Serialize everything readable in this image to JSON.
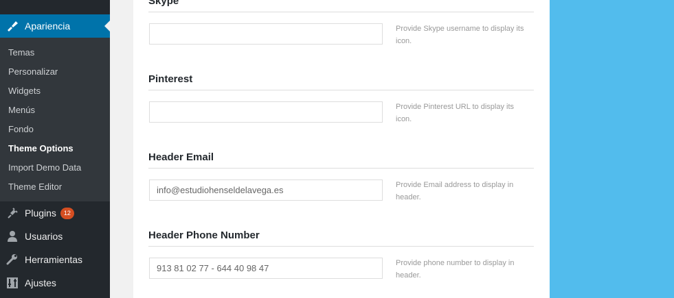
{
  "sidebar": {
    "appearance_label": "Apariencia",
    "submenu": [
      {
        "label": "Temas"
      },
      {
        "label": "Personalizar"
      },
      {
        "label": "Widgets"
      },
      {
        "label": "Menús"
      },
      {
        "label": "Fondo"
      },
      {
        "label": "Theme Options",
        "current": true
      },
      {
        "label": "Import Demo Data"
      },
      {
        "label": "Theme Editor"
      }
    ],
    "plugins_label": "Plugins",
    "plugins_badge": "12",
    "users_label": "Usuarios",
    "tools_label": "Herramientas",
    "settings_label": "Ajustes"
  },
  "fields": {
    "skype": {
      "title": "Skype",
      "value": "",
      "desc": "Provide Skype username to display its icon."
    },
    "pinterest": {
      "title": "Pinterest",
      "value": "",
      "desc": "Provide Pinterest URL to display its icon."
    },
    "email": {
      "title": "Header Email",
      "value": "info@estudiohenseldelavega.es",
      "desc": "Provide Email address to display in header."
    },
    "phone": {
      "title": "Header Phone Number",
      "value": "913 81 02 77 - 644 40 98 47",
      "desc": "Provide phone number to display in header."
    }
  },
  "colors": {
    "sidebar_bg": "#23282d",
    "submenu_bg": "#32373c",
    "active_menu": "#0073aa",
    "badge": "#d54e21",
    "right_area": "#52bced"
  }
}
